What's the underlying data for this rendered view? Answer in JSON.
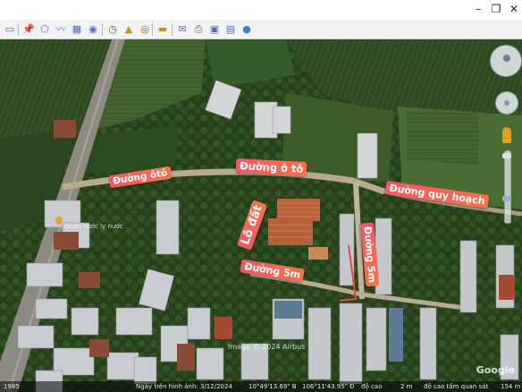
{
  "window": {
    "minimize": "–",
    "maximize": "❐",
    "close": "✕"
  },
  "toolbar": {
    "buttons": [
      {
        "name": "sidebar-toggle-icon",
        "glyph": "▭",
        "color": "#3a6fd0"
      },
      {
        "name": "placemark-icon",
        "glyph": "📌",
        "color": "#e0a000"
      },
      {
        "name": "polygon-icon",
        "glyph": "⬠",
        "color": "#4a6fbf"
      },
      {
        "name": "path-icon",
        "glyph": "〰",
        "color": "#4a6fbf"
      },
      {
        "name": "overlay-icon",
        "glyph": "▦",
        "color": "#4a6fbf"
      },
      {
        "name": "tour-icon",
        "glyph": "◉",
        "color": "#4a6fbf"
      },
      {
        "name": "historical-imagery-icon",
        "glyph": "◷",
        "color": "#2f8a3a"
      },
      {
        "name": "sunlight-icon",
        "glyph": "▲",
        "color": "#d28a1f"
      },
      {
        "name": "planets-icon",
        "glyph": "◎",
        "color": "#b06010"
      },
      {
        "name": "ruler-icon",
        "glyph": "▬",
        "color": "#c09020"
      },
      {
        "name": "email-icon",
        "glyph": "✉",
        "color": "#4a6fbf"
      },
      {
        "name": "print-icon",
        "glyph": "⎙",
        "color": "#555555"
      },
      {
        "name": "save-image-icon",
        "glyph": "▣",
        "color": "#4a6fbf"
      },
      {
        "name": "maps-icon",
        "glyph": "▤",
        "color": "#4a6fbf"
      },
      {
        "name": "earth-icon",
        "glyph": "●",
        "color": "#3a7fd0"
      }
    ]
  },
  "labels": {
    "road_oto_left": "Đường ôtô",
    "road_oto_right": "Đường ô tô",
    "road_planned": "Đường quy hoạch",
    "lot": "Lô đất",
    "road_5m_vertical": "Đường 5m",
    "road_5m_horizontal": "Đường 5m"
  },
  "map_place_label": "Quán nước ly nước",
  "imagery_credit": "Image © 2024 Airbus",
  "google_logo": "Google",
  "status": {
    "year": "1985",
    "imagery_date": "Ngày trên hình ảnh: 3/12/2024",
    "lat": "10°49'13.69\" B",
    "lon": "106°11'43.95\" Đ",
    "elevation": "độ cao",
    "elevation_value": "2 m",
    "eye_alt": "độ cao tầm quan sát",
    "eye_alt_value": "154 m"
  },
  "colors": {
    "label_start": "#f0566a",
    "label_end": "#f4734a"
  }
}
